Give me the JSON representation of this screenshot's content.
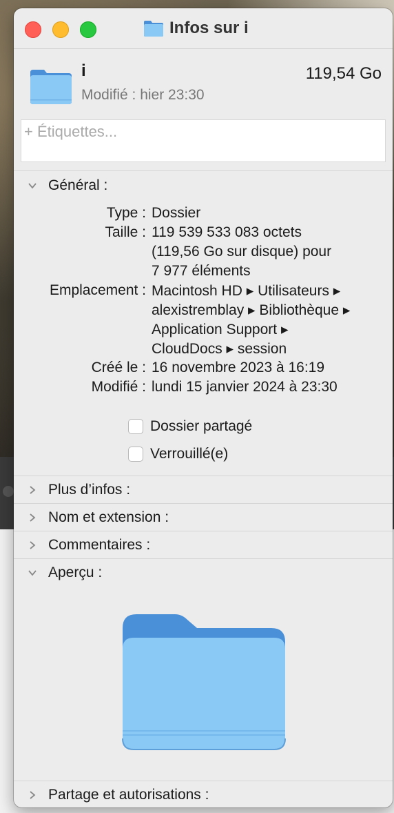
{
  "window": {
    "title": "Infos sur i"
  },
  "header": {
    "name": "i",
    "size": "119,54 Go",
    "modified": "Modifié : hier 23:30"
  },
  "tags": {
    "placeholder": "+ Étiquettes..."
  },
  "general": {
    "label": "Général :",
    "rows": [
      {
        "key": "Type :",
        "lines": [
          "Dossier"
        ]
      },
      {
        "key": "Taille :",
        "lines": [
          "119 539 533 083 octets",
          "(119,56 Go sur disque) pour",
          "7 977 éléments"
        ]
      },
      {
        "key": "Emplacement :",
        "lines": [
          "Macintosh HD ▸ Utilisateurs ▸",
          "alexistremblay ▸ Bibliothèque ▸",
          "Application Support ▸",
          "CloudDocs ▸ session"
        ]
      },
      {
        "key": "Créé le :",
        "lines": [
          "16 novembre 2023 à 16:19"
        ]
      },
      {
        "key": "Modifié :",
        "lines": [
          "lundi 15 janvier 2024 à 23:30"
        ]
      }
    ],
    "shared_folder_label": "Dossier partagé",
    "locked_label": "Verrouillé(e)",
    "shared_folder_checked": false,
    "locked_checked": false
  },
  "sections": {
    "more_info": "Plus d’infos :",
    "name_extension": "Nom et extension :",
    "comments": "Commentaires :",
    "preview": "Aperçu :",
    "sharing": "Partage et autorisations :"
  },
  "colors": {
    "folder_light": "#8ac8f5",
    "folder_dark": "#4a90d9",
    "close": "#ff5f57",
    "minimize": "#febc2e",
    "zoom": "#28c840"
  }
}
